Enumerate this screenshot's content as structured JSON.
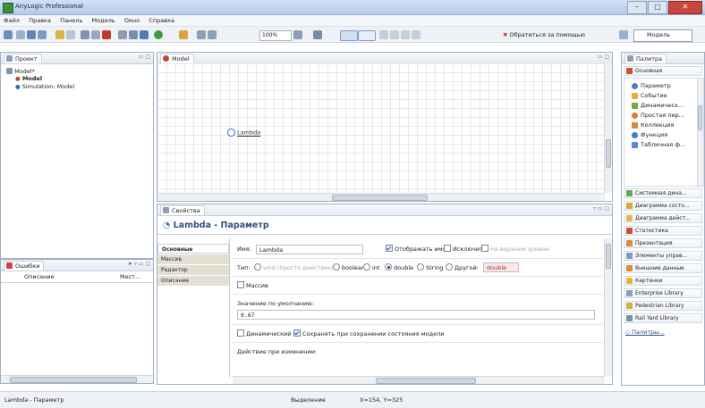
{
  "window": {
    "title": "AnyLogic Professional",
    "buttons": {
      "minimize": "–",
      "maximize": "□",
      "close": "✕"
    }
  },
  "menu": [
    "Файл",
    "Правка",
    "Панель",
    "Модель",
    "Окно",
    "Справка"
  ],
  "toolbar": {
    "zoom": "100%",
    "help_label": "Обратиться за помощью",
    "model_button": "Модель"
  },
  "project_panel": {
    "tab_label": "Проект",
    "tree": [
      "Model*",
      "Model",
      "Simulation: Model"
    ]
  },
  "errors_panel": {
    "tab_label": "Ошибки",
    "columns": [
      "Описание",
      "Мест..."
    ]
  },
  "editor": {
    "tab_label": "Model",
    "element_label": "Lambda"
  },
  "properties": {
    "tab_label": "Свойства",
    "title": "Lambda - Параметр",
    "side_tabs": [
      "Основные",
      "Массив",
      "Редактор",
      "Описание"
    ],
    "name_label": "Имя:",
    "name_value": "Lambda",
    "show_name": "Отображать имя",
    "exclude": "Исключить",
    "top_level": "На верхнем уровне",
    "type_label": "Тип:",
    "types": [
      "void (просто действие)",
      "boolean",
      "int",
      "double",
      "String",
      "Другой:"
    ],
    "type_selected": "double",
    "type_field": "double",
    "array_label": "Массив",
    "default_label": "Значение по умолчанию:",
    "default_value": "0.67",
    "dynamic_label": "Динамический",
    "save_label": "Сохранять при сохранении состояния модели",
    "action_label": "Действие при изменении:"
  },
  "palette": {
    "tab_label": "Палитра",
    "section": "Основная",
    "items": [
      "Параметр",
      "Событие",
      "Динамическ...",
      "Простая пер...",
      "Коллекция",
      "Функция",
      "Табличная ф..."
    ],
    "sections": [
      "Системная дина...",
      "Диаграмма состо...",
      "Диаграмма дейст...",
      "Статистика",
      "Презентация",
      "Элементы управ...",
      "Внешние данные",
      "Картинки",
      "Enterprise Library",
      "Pedestrian Library",
      "Rail Yard Library"
    ],
    "link": "Палитры..."
  },
  "status": {
    "left": "Lambda - Параметр",
    "selection_label": "Выделение",
    "coords": "X=154, Y=325"
  },
  "colors": {
    "accent": "#2f4f7f",
    "frame": "#9fb0c4",
    "titlebar": "#b4cbe6"
  }
}
